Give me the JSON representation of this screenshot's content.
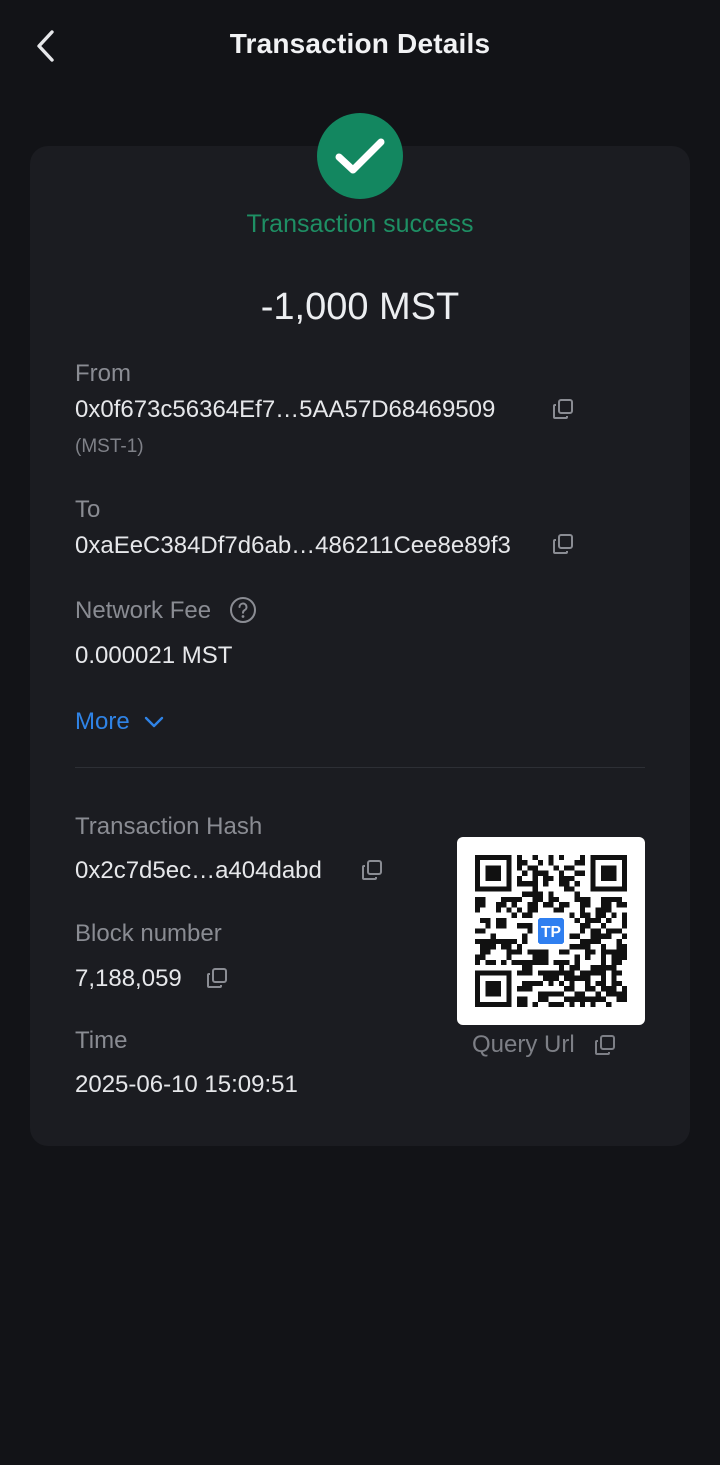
{
  "header": {
    "title": "Transaction Details"
  },
  "status": {
    "text": "Transaction success"
  },
  "amount": "-1,000 MST",
  "from": {
    "label": "From",
    "address": "0x0f673c56364Ef7…5AA57D68469509",
    "network": "(MST-1)"
  },
  "to": {
    "label": "To",
    "address": "0xaEeC384Df7d6ab…486211Cee8e89f3"
  },
  "fee": {
    "label": "Network Fee",
    "value": "0.000021 MST"
  },
  "more": {
    "label": "More"
  },
  "hash": {
    "label": "Transaction Hash",
    "value": "0x2c7d5ec…a404dabd"
  },
  "block": {
    "label": "Block number",
    "value": "7,188,059"
  },
  "time": {
    "label": "Time",
    "value": "2025-06-10 15:09:51"
  },
  "qr": {
    "label": "Query Url",
    "logo_text": "TP"
  },
  "colors": {
    "success": "#138760",
    "accent": "#2f83e6",
    "card": "#1b1c21",
    "background": "#121317"
  }
}
